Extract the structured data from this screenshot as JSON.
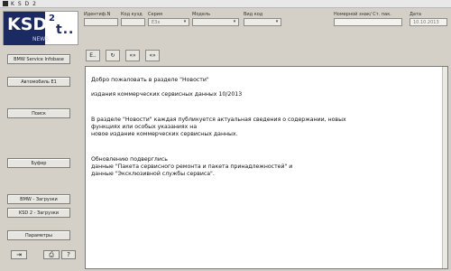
{
  "window": {
    "title": "K S D 2"
  },
  "logo": {
    "brand": "KSD",
    "sup": "2",
    "suffix": "t..",
    "sub": "NEWS"
  },
  "header": {
    "fields": [
      {
        "label": "Идентиф.N",
        "value": ""
      },
      {
        "label": "Код кузд",
        "value": ""
      },
      {
        "label": "Серия",
        "value": "E3x"
      },
      {
        "label": "Модель",
        "value": ""
      },
      {
        "label": "Вид код",
        "value": ""
      },
      {
        "label": "Номерной знак/ Ст. пак.",
        "value": ""
      },
      {
        "label": "Дата",
        "value": "10.10.2013"
      }
    ]
  },
  "sidebar": {
    "top_button": "BMW Service Infobase",
    "buttons": [
      "Автомобиль E1",
      "Поиск",
      "Буфер",
      "BMW - Загрузки",
      "KSD 2 - Загрузки",
      "Параметры"
    ],
    "bottom_icons": [
      "exit-icon",
      "print-icon",
      "help-icon"
    ]
  },
  "toolbar": {
    "buttons": [
      "E..",
      "↻",
      "«»",
      "«»"
    ]
  },
  "content": {
    "lines": [
      "Добро пожаловать в разделе \"Новости\"",
      "издания коммерческих сервисных данных 10/2013",
      "В разделе \"Новости\" каждая публикуется актуальная сведения о содержании, новых",
      "функциях или особых указаниях на",
      "новое издание коммерческих сервисных данных.",
      "Обновлению подверглись",
      "данные \"Пакета сервисного ремонта и пакета принадлежностей\" и",
      "данные \"Эксклюзивной службы сервиса\"."
    ]
  }
}
